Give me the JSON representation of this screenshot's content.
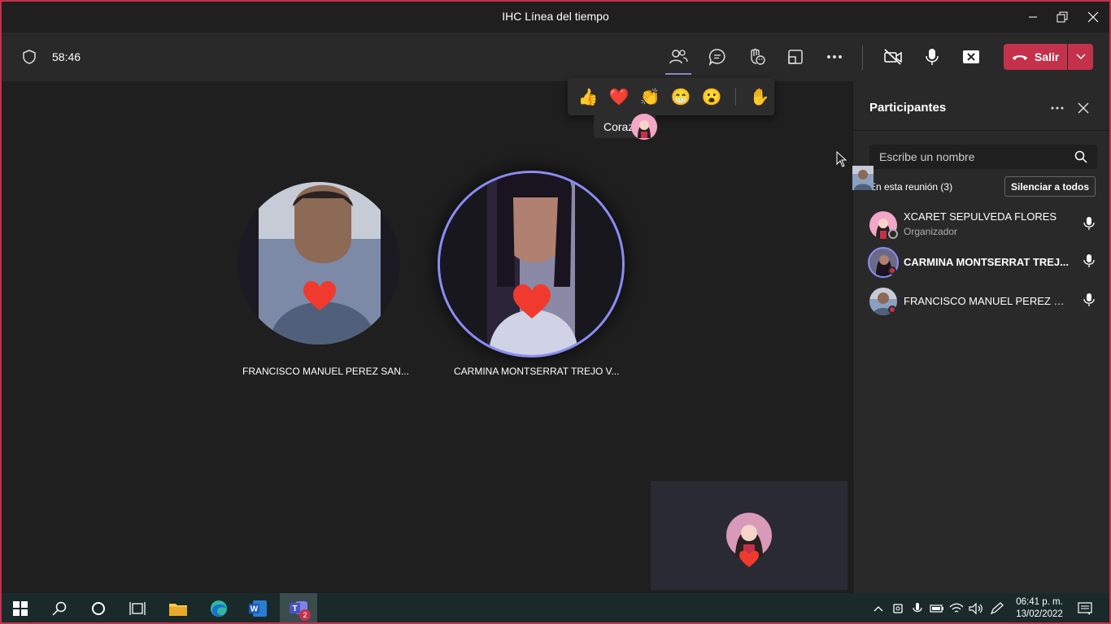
{
  "window": {
    "title": "IHC Línea del tiempo"
  },
  "header": {
    "timer": "58:46",
    "leave_label": "Salir",
    "icons": [
      "shield-icon",
      "participants-icon",
      "chat-icon",
      "reactions-icon",
      "share-tray-icon",
      "more-icon",
      "camera-off-icon",
      "mic-icon",
      "share-stop-icon",
      "phone-hangup-icon",
      "chevron-down-icon"
    ]
  },
  "reactions": {
    "items": [
      "👍",
      "❤️",
      "👏",
      "😁",
      "😮"
    ],
    "raise_hand": "✋",
    "tooltip": "Corazón"
  },
  "stage": {
    "tiles": [
      {
        "name": "FRANCISCO MANUEL PEREZ SAN..."
      },
      {
        "name": "CARMINA MONTSERRAT TREJO V..."
      }
    ]
  },
  "panel": {
    "title": "Participantes",
    "search_placeholder": "Escribe un nombre",
    "in_meeting": "En esta reunión (3)",
    "mute_all": "Silenciar a todos",
    "participants": [
      {
        "name": "XCARET SEPULVEDA FLORES",
        "role": "Organizador"
      },
      {
        "name": "CARMINA MONTSERRAT TREJ...",
        "role": ""
      },
      {
        "name": "FRANCISCO MANUEL PEREZ SA...",
        "role": ""
      }
    ]
  },
  "taskbar": {
    "time": "06:41 p. m.",
    "date": "13/02/2022",
    "teams_badge": "2",
    "word_letter": "W",
    "teams_letter": "T"
  },
  "colors": {
    "accent": "#c4314b",
    "speaking_ring": "#8b8cf7",
    "heart": "#f03a2e"
  }
}
